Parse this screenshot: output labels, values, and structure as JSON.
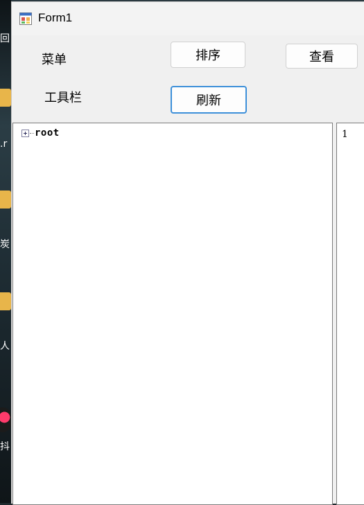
{
  "window": {
    "title": "Form1",
    "icon": "winforms-app-icon"
  },
  "labels": {
    "menu": "菜单",
    "toolbar": "工具栏"
  },
  "buttons": {
    "sort": "排序",
    "view": "查看",
    "refresh": "刷新"
  },
  "tree": {
    "nodes": [
      {
        "label": "root",
        "expanded": false
      }
    ]
  },
  "right_panel": {
    "text": "1"
  },
  "desktop": {
    "labels": [
      "回",
      ".r",
      "炭",
      "人",
      "抖"
    ]
  },
  "colors": {
    "focus_border": "#3c8fd9",
    "window_bg": "#f0f0f0"
  }
}
